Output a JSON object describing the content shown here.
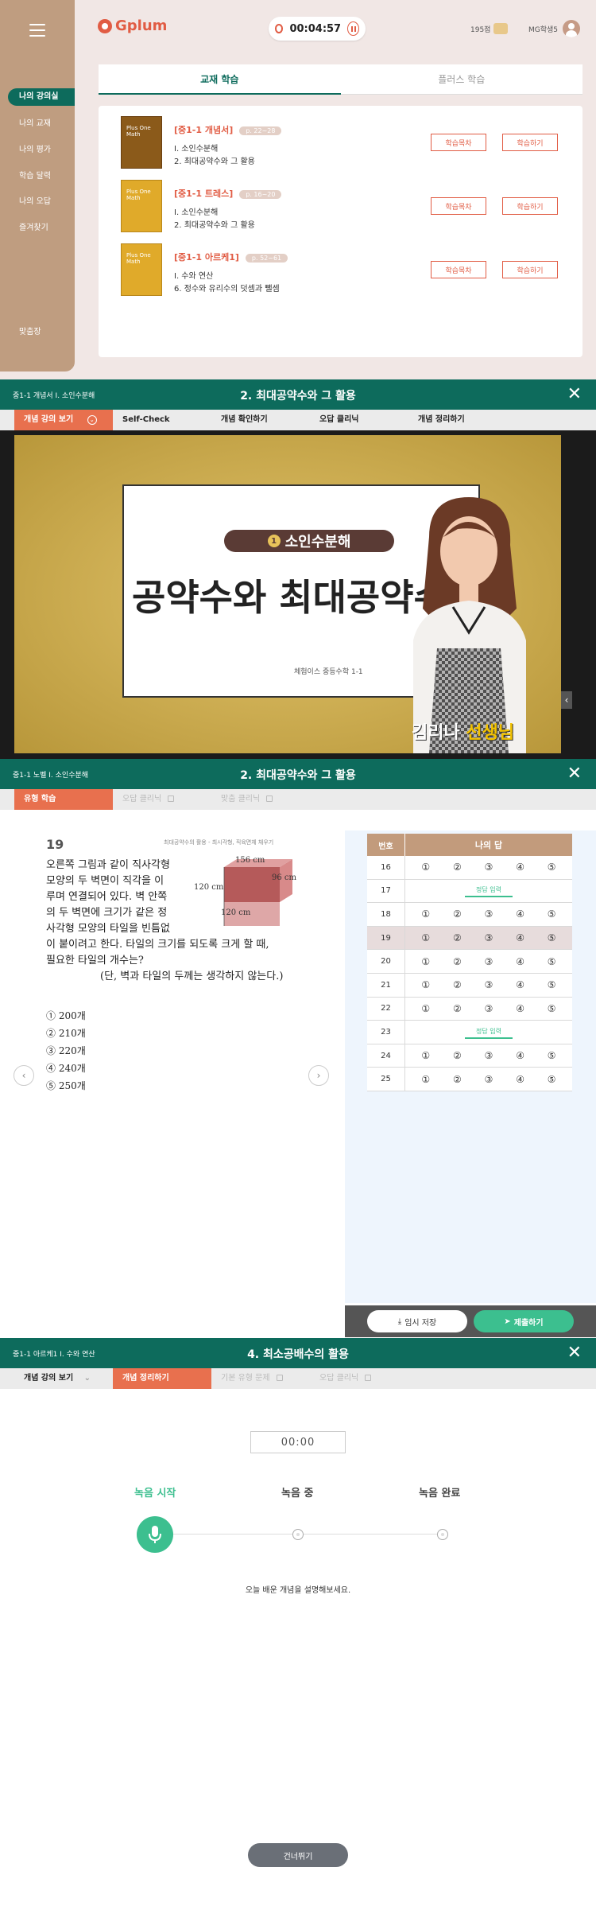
{
  "app": {
    "logo": "Gplum",
    "timer": "00:04:57",
    "points": "195점",
    "user": "MG학생5"
  },
  "sidebar": {
    "items": [
      "나의 강의실",
      "나의 교재",
      "나의 평가",
      "학습 달력",
      "나의 오답",
      "즐겨찾기"
    ],
    "active_index": 0,
    "bottom": "맞춤장"
  },
  "main_tabs": [
    "교재 학습",
    "플러스 학습"
  ],
  "books": [
    {
      "title": "[중1-1 개념서]",
      "pages": "p. 22~28",
      "line1": "Ⅰ. 소인수분해",
      "line2": "2. 최대공약수와 그 활용",
      "btn1": "학습목차",
      "btn2": "학습하기",
      "color": "#8b5a1a"
    },
    {
      "title": "[중1-1 트레스]",
      "pages": "p. 16~20",
      "line1": "Ⅰ. 소인수분해",
      "line2": "2. 최대공약수와 그 활용",
      "btn1": "학습목차",
      "btn2": "학습하기",
      "color": "#e0aa2a"
    },
    {
      "title": "[중1-1 아르케1]",
      "pages": "p. 52~61",
      "line1": "Ⅰ. 수와 연산",
      "line2": "6. 정수와 유리수의 덧셈과 뺄셈",
      "btn1": "학습목차",
      "btn2": "학습하기",
      "color": "#e0aa2a"
    }
  ],
  "book_cover_text": "Plus One Math",
  "video_section": {
    "crumb": "중1-1 개념서 Ⅰ. 소인수분해",
    "title": "2. 최대공약수와 그 활용",
    "tabs": [
      "개념 강의 보기",
      "Self-Check",
      "개념 확인하기",
      "오답 클리닉",
      "개념 정리하기"
    ],
    "active_tab": 0,
    "board_number": "1",
    "board_chip": "소인수분해",
    "board_headline": "공약수와 최대공약수",
    "board_caption": "체험이스 중등수학 1-1",
    "teacher_name": "김리나",
    "teacher_suffix": "선생님"
  },
  "quiz_section": {
    "crumb": "중1-1 노벨 Ⅰ. 소인수분해",
    "title": "2. 최대공약수와 그 활용",
    "tabs": [
      "유형 학습",
      "오답 클리닉",
      "맞춤 클리닉"
    ],
    "question_no": "19",
    "question_tag": "최대공약수의 활용 - 최시각형, 직육면체 채우기",
    "question_lines": [
      "오른쪽 그림과 같이 직사각형",
      "모양의 두 벽면이 직각을 이",
      "루며 연결되어 있다. 벽 안쪽",
      "의 두 벽면에 크기가 같은 정",
      "사각형 모양의 타일을 빈틈없",
      "이 붙이려고 한다. 타일의 크기를 되도록 크게 할 때,",
      "필요한 타일의 개수는?",
      "(단, 벽과 타일의 두께는 생각하지 않는다.)"
    ],
    "figure_labels": [
      "156 cm",
      "96 cm",
      "120 cm",
      "120 cm"
    ],
    "options": [
      "① 200개",
      "② 210개",
      "③ 220개",
      "④ 240개",
      "⑤ 250개"
    ],
    "answer_headers": [
      "번호",
      "나의 답"
    ],
    "answer_rows": [
      {
        "no": "16",
        "type": "choice"
      },
      {
        "no": "17",
        "type": "input"
      },
      {
        "no": "18",
        "type": "choice"
      },
      {
        "no": "19",
        "type": "choice",
        "highlight": true
      },
      {
        "no": "20",
        "type": "choice"
      },
      {
        "no": "21",
        "type": "choice"
      },
      {
        "no": "22",
        "type": "choice"
      },
      {
        "no": "23",
        "type": "input"
      },
      {
        "no": "24",
        "type": "choice"
      },
      {
        "no": "25",
        "type": "choice"
      }
    ],
    "choice_marks": [
      "①",
      "②",
      "③",
      "④",
      "⑤"
    ],
    "input_label": "정답 입력",
    "save_btn": "임시 저장",
    "submit_btn": "제출하기"
  },
  "record_section": {
    "crumb": "중1-1 아르케1 Ⅰ. 수와 연산",
    "title": "4. 최소공배수의 활용",
    "tabs": [
      "개념 강의 보기",
      "개념 정리하기",
      "기본 유형 문제",
      "오답 클리닉"
    ],
    "active_tab": 1,
    "timer": "00:00",
    "steps": [
      "녹음 시작",
      "녹음 중",
      "녹음 완료"
    ],
    "hint": "오늘 배운 개념을 설명해보세요.",
    "skip_btn": "건너뛰기"
  }
}
